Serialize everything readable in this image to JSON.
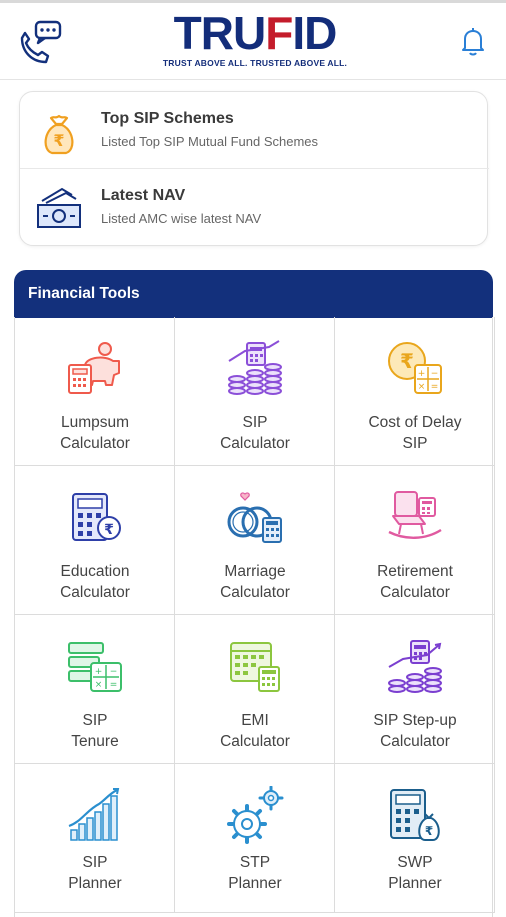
{
  "header": {
    "logo_text_1": "TRU",
    "logo_text_f": "F",
    "logo_text_2": "ID",
    "tagline": "TRUST ABOVE ALL. TRUSTED ABOVE ALL.",
    "brand_colors": {
      "navy": "#132d7a",
      "red": "#c41c2b"
    }
  },
  "quick_links": [
    {
      "title": "Top SIP Schemes",
      "subtitle": "Listed Top SIP Mutual Fund Schemes",
      "icon": "money-bag-icon"
    },
    {
      "title": "Latest NAV",
      "subtitle": "Listed AMC wise latest NAV",
      "icon": "cash-notes-icon"
    }
  ],
  "tools": {
    "title": "Financial Tools",
    "header_color": "#13307c",
    "items": [
      {
        "line1": "Lumpsum",
        "line2": "Calculator",
        "icon": "piggy-bank-calculator-icon",
        "color": "#ef5a4c"
      },
      {
        "line1": "SIP",
        "line2": "Calculator",
        "icon": "coins-calculator-icon",
        "color": "#8b4fd8"
      },
      {
        "line1": "Cost of Delay",
        "line2": "SIP",
        "icon": "rupee-coin-calculator-icon",
        "color": "#e9a61c"
      },
      {
        "line1": "Education",
        "line2": "Calculator",
        "icon": "education-calculator-icon",
        "color": "#2e3fa8"
      },
      {
        "line1": "Marriage",
        "line2": "Calculator",
        "icon": "rings-calculator-icon",
        "color": "#2a6fb0"
      },
      {
        "line1": "Retirement",
        "line2": "Calculator",
        "icon": "rocking-chair-icon",
        "color": "#e05aa0"
      },
      {
        "line1": "SIP",
        "line2": "Tenure",
        "icon": "sip-tenure-icon",
        "color": "#3cbf6a"
      },
      {
        "line1": "EMI",
        "line2": "Calculator",
        "icon": "emi-calendar-icon",
        "color": "#8cc63f"
      },
      {
        "line1": "SIP Step-up",
        "line2": "Calculator",
        "icon": "step-up-coins-icon",
        "color": "#7b3fd0"
      },
      {
        "line1": "SIP",
        "line2": "Planner",
        "icon": "growth-bars-icon",
        "color": "#2a8fcf"
      },
      {
        "line1": "STP",
        "line2": "Planner",
        "icon": "gears-icon",
        "color": "#2a8fcf"
      },
      {
        "line1": "SWP",
        "line2": "Planner",
        "icon": "calculator-bag-icon",
        "color": "#1b5e8c"
      }
    ]
  }
}
